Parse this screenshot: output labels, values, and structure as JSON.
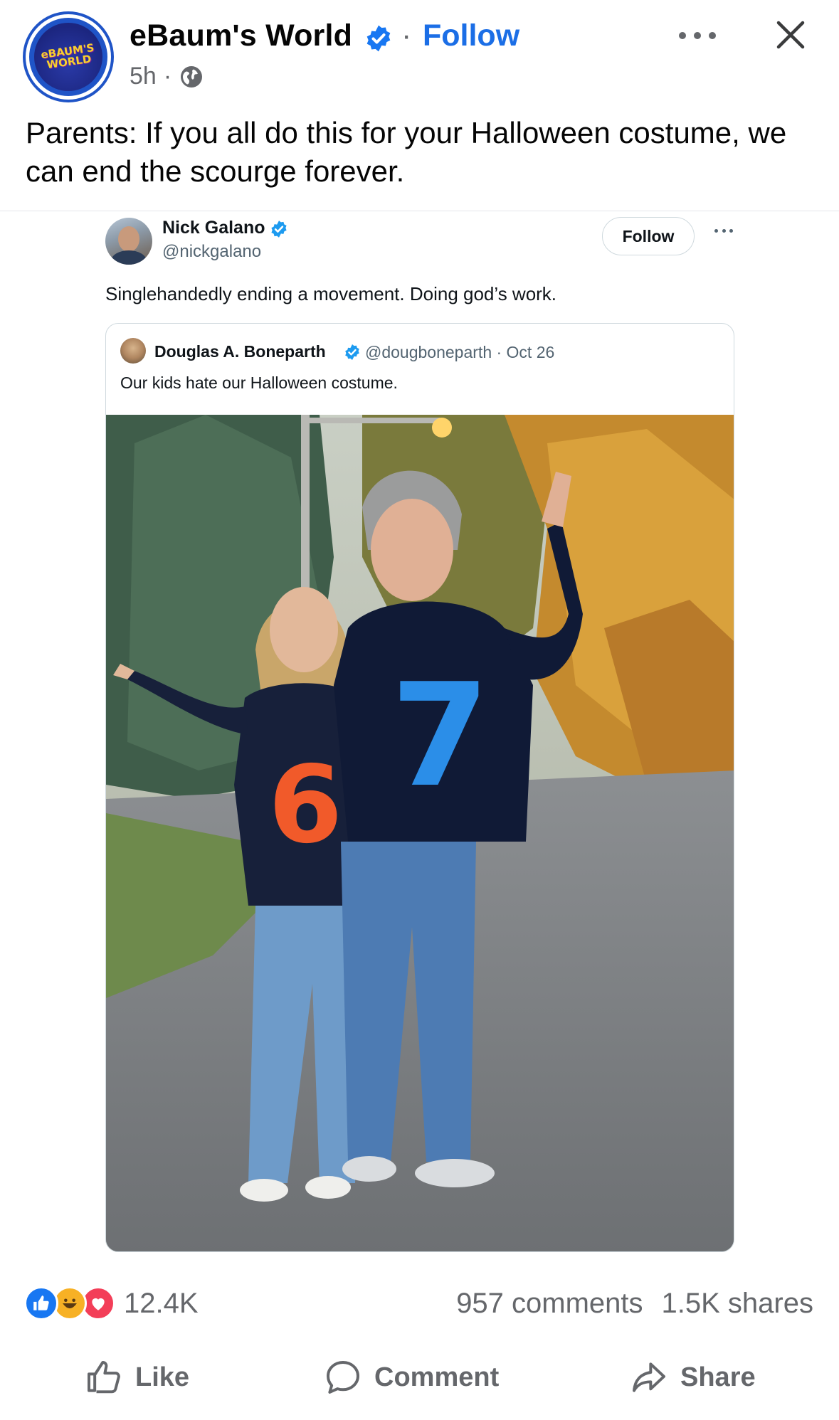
{
  "post": {
    "page_name": "eBaum's World",
    "follow_label": "Follow",
    "separator": "·",
    "time": "5h",
    "meta_separator": "·",
    "logo_text": "eBAUM'S WORLD",
    "caption": "Parents: If you all do this for your Halloween costume, we can end the scourge forever."
  },
  "tweet": {
    "author_name": "Nick Galano",
    "author_handle": "@nickgalano",
    "follow_label": "Follow",
    "text": "Singlehandedly ending a movement. Doing god’s work.",
    "quoted": {
      "author_name": "Douglas A. Boneparth",
      "handle_and_date": "@dougboneparth · Oct 26",
      "text": "Our kids hate our Halloween costume.",
      "shirt_left_number": "6",
      "shirt_right_number": "7"
    }
  },
  "engagement": {
    "reaction_count": "12.4K",
    "comments": "957 comments",
    "shares": "1.5K shares"
  },
  "actions": {
    "like": "Like",
    "comment": "Comment",
    "share": "Share"
  },
  "colors": {
    "accent": "#1b6ee6",
    "text_secondary": "#65676b",
    "like_blue": "#1877f2",
    "haha_yellow": "#f7b125",
    "love_red": "#f33e58",
    "six_orange": "#f15a2a",
    "seven_blue": "#2b8ee8"
  }
}
